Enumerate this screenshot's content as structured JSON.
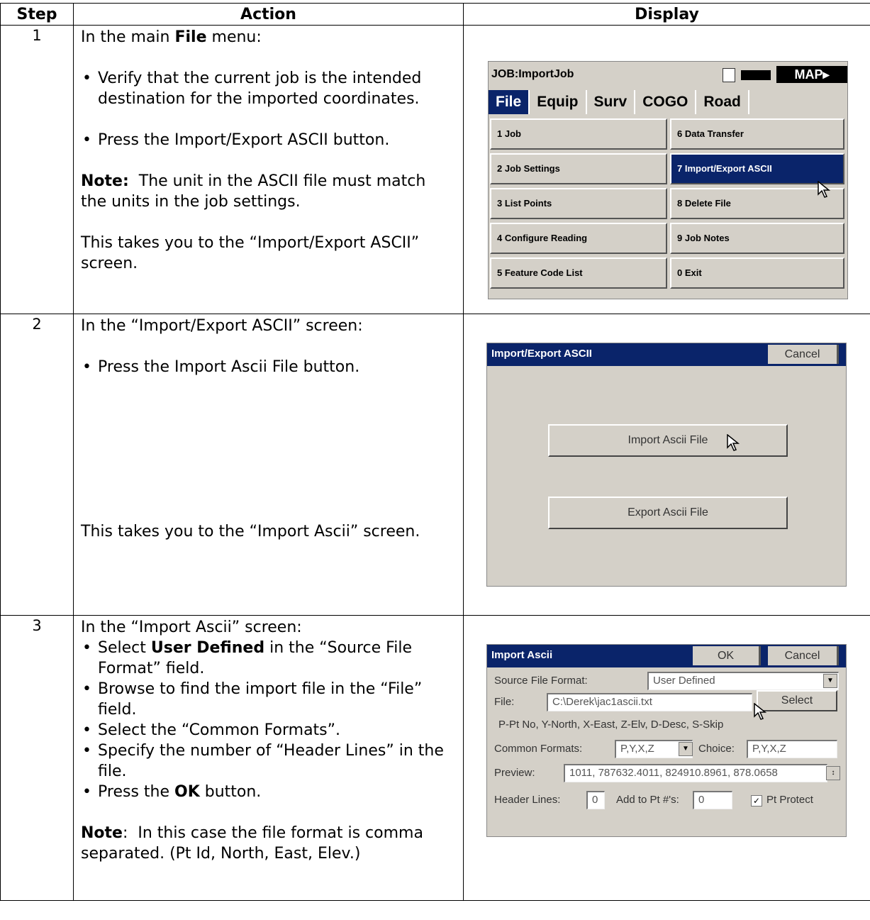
{
  "headers": {
    "step": "Step",
    "action": "Action",
    "display": "Display"
  },
  "row1": {
    "step": "1",
    "intro_pre": "In the main ",
    "intro_bold": "File",
    "intro_post": " menu:",
    "bullet1": "Verify that the current job is the intended destination for the imported coordinates.",
    "bullet2": "Press the Import/Export ASCII button.",
    "note_bold": "Note:",
    "note_text": "  The unit in the ASCII file must match the units in the job settings.",
    "outro": "This takes you to the “Import/Export ASCII” screen.",
    "screen": {
      "title": "JOB:ImportJob",
      "map_label": "MAP▸",
      "tabs": [
        "File",
        "Equip",
        "Surv",
        "COGO",
        "Road"
      ],
      "left_buttons": [
        "1 Job",
        "2 Job Settings",
        "3 List Points",
        "4 Configure Reading",
        "5 Feature Code List"
      ],
      "right_buttons": [
        "6 Data Transfer",
        "7 Import/Export ASCII",
        "8 Delete File",
        "9 Job Notes",
        "0 Exit"
      ]
    }
  },
  "row2": {
    "step": "2",
    "intro": "In the “Import/Export ASCII” screen:",
    "bullet1": "Press the Import Ascii File button.",
    "outro": "This takes you to the “Import Ascii” screen.",
    "screen": {
      "title": "Import/Export ASCII",
      "cancel": "Cancel",
      "import_btn": "Import Ascii File",
      "export_btn": "Export Ascii File"
    }
  },
  "row3": {
    "step": "3",
    "intro": "In the “Import Ascii” screen:",
    "b1_pre": "Select ",
    "b1_bold": "User Defined",
    "b1_post": " in the “Source File Format” field.",
    "b2": "Browse to find the import file in the “File” field.",
    "b3": "Select the “Common Formats”.",
    "b4": "Specify the number of “Header Lines” in the file.",
    "b5_pre": "Press the ",
    "b5_bold": "OK",
    "b5_post": " button.",
    "note_bold": "Note",
    "note_text": ":  In this case the file format is comma separated. (Pt Id, North, East, Elev.)",
    "screen": {
      "title": "Import Ascii",
      "ok": "OK",
      "cancel": "Cancel",
      "source_label": "Source File Format:",
      "source_value": "User Defined",
      "file_label": "File:",
      "file_value": "C:\\Derek\\jac1ascii.txt",
      "select_btn": "Select",
      "legend": "P-Pt No, Y-North, X-East, Z-Elv, D-Desc, S-Skip",
      "common_label": "Common Formats:",
      "common_value": "P,Y,X,Z",
      "choice_label": "Choice:",
      "choice_value": "P,Y,X,Z",
      "preview_label": "Preview:",
      "preview_value": "1011, 787632.4011, 824910.8961, 878.0658",
      "header_label": "Header Lines:",
      "header_value": "0",
      "add_label": "Add to Pt #'s:",
      "add_value": "0",
      "protect_label": "Pt Protect"
    }
  }
}
